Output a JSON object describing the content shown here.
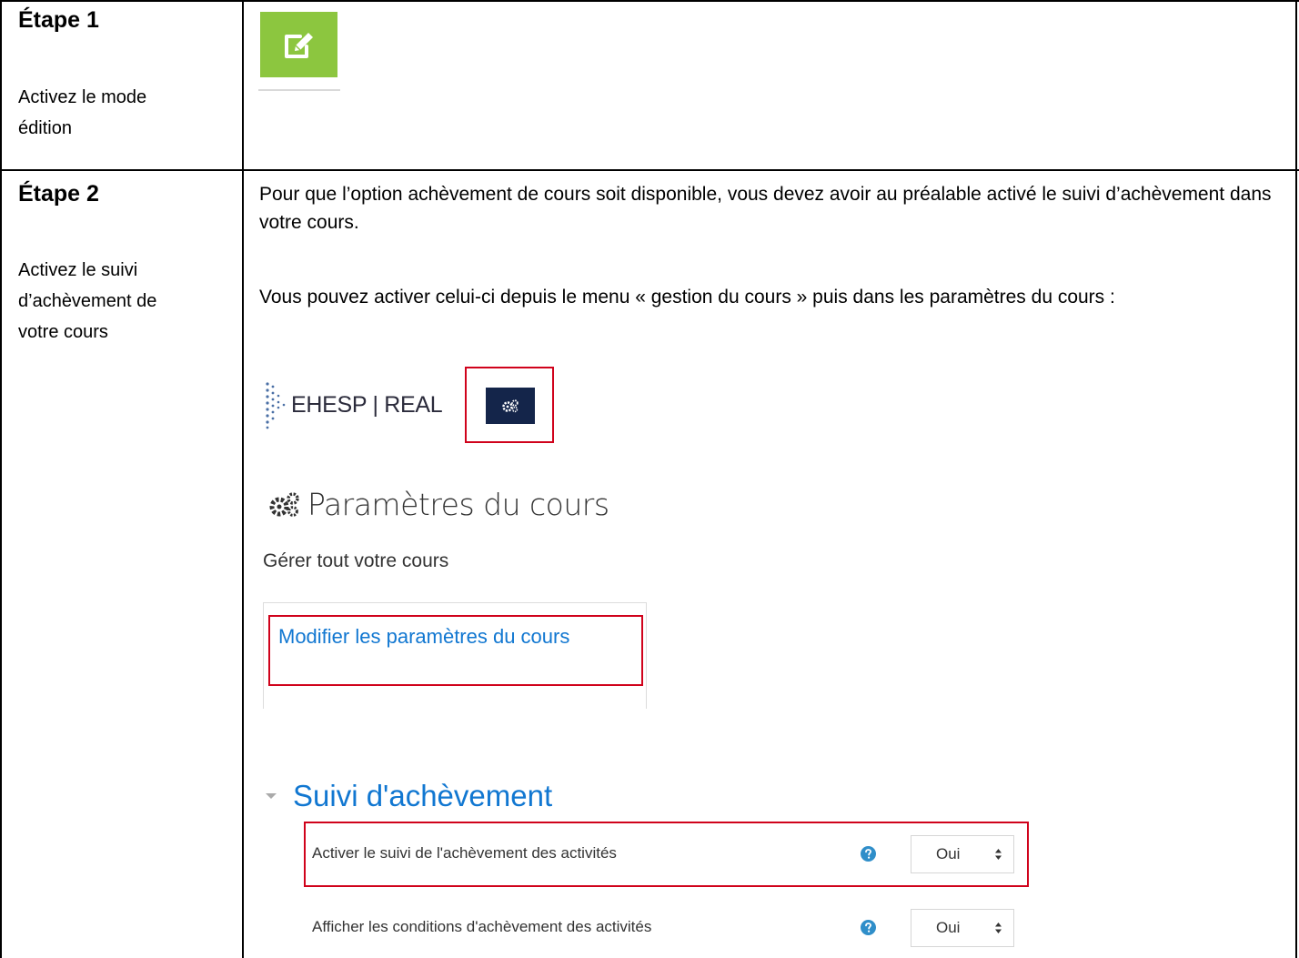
{
  "steps": [
    {
      "title": "Étape 1",
      "description": "Activez le mode édition"
    },
    {
      "title": "Étape 2",
      "description": "Activez le suivi d’achèvement de votre cours",
      "paragraphs": [
        "Pour que l’option achèvement de cours soit disponible, vous devez avoir au préalable activé le suivi d’achèvement dans votre cours.",
        "Vous pouvez activer celui-ci depuis le menu « gestion du cours » puis dans les paramètres du cours :"
      ]
    }
  ],
  "screenshot": {
    "logo_text": "EHESP | REAL",
    "params_title": "Paramètres du cours",
    "params_subtitle": "Gérer tout votre cours",
    "menu_link": "Modifier les paramètres du cours",
    "section_title": "Suivi d'achèvement",
    "settings": [
      {
        "label": "Activer le suivi de l'achèvement des activités",
        "value": "Oui"
      },
      {
        "label": "Afficher les conditions d'achèvement des activités",
        "value": "Oui"
      }
    ]
  },
  "colors": {
    "edit_green": "#8cc63f",
    "gear_navy": "#14254a",
    "link_blue": "#1177d1",
    "highlight_red": "#d0021b",
    "help_blue": "#2f8ec9"
  },
  "icons": {
    "edit": "pencil-square-icon",
    "gear": "cogs-icon",
    "logo": "dot-pattern-logo-icon",
    "caret": "triangle-down-icon",
    "help": "question-circle-icon",
    "select": "up-down-arrows-icon"
  }
}
